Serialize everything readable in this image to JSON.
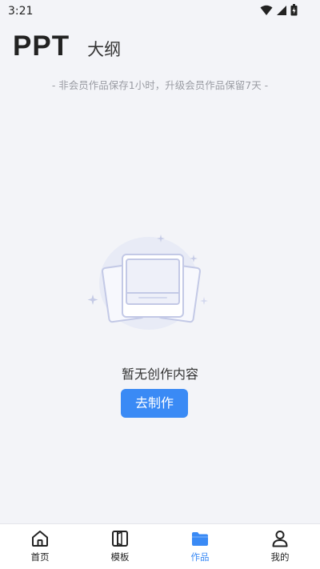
{
  "status_bar": {
    "time": "3:21",
    "icons": [
      "wifi-icon",
      "signal-icon",
      "battery-icon"
    ]
  },
  "header": {
    "tabs": [
      {
        "label": "PPT",
        "active": true
      },
      {
        "label": "大纲",
        "active": false
      }
    ]
  },
  "notice": "- 非会员作品保存1小时，升级会员作品保留7天 -",
  "empty_state": {
    "message": "暂无创作内容",
    "button_label": "去制作"
  },
  "bottom_nav": {
    "items": [
      {
        "label": "首页",
        "icon": "home-icon",
        "active": false
      },
      {
        "label": "模板",
        "icon": "template-icon",
        "active": false
      },
      {
        "label": "作品",
        "icon": "folder-icon",
        "active": true
      },
      {
        "label": "我的",
        "icon": "user-icon",
        "active": false
      }
    ]
  },
  "colors": {
    "accent": "#3a8af5",
    "background": "#f3f4f8",
    "nav_background": "#ffffff"
  }
}
